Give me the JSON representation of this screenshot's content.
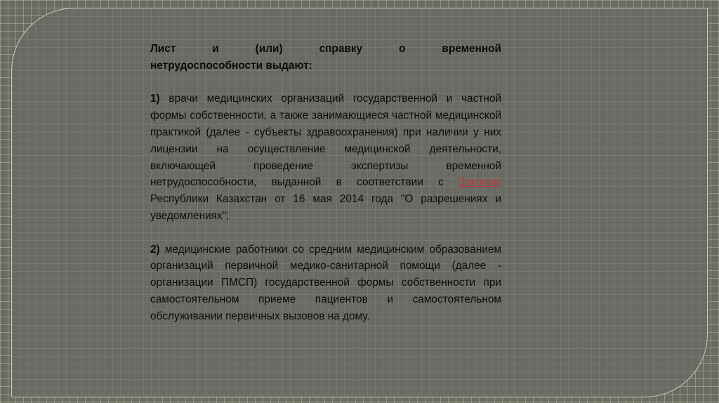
{
  "slide": {
    "heading_line1": "Лист и (или) справку о временной",
    "heading_line2": "нетрудоспособности выдают:",
    "item1": {
      "number": "1)",
      "text_before_link": " врачи медицинских организаций государственной и частной формы собственности, а также занимающиеся частной медицинской практикой (далее - субъекты здравоохранения) при наличии у них лицензии на осуществление медицинской деятельности, включающей проведение экспертизы временной нетрудоспособности, выданной в соответствии с ",
      "link_text": "Законом",
      "text_after_link": " Республики Казахстан от 16 мая 2014 года \"О разрешениях и уведомлениях\";"
    },
    "item2": {
      "number": "2)",
      "text": " медицинские работники со средним медицинским образованием организаций первичной медико-санитарной помощи (далее - организации ПМСП) государственной формы собственности при самостоятельном приеме пациентов и самостоятельном обслуживании первичных вызовов на дому."
    }
  },
  "colors": {
    "background": "#6b6c5f",
    "frame_border": "#c9c9bd",
    "text": "#0b0b0b",
    "link": "#b53a3a"
  }
}
